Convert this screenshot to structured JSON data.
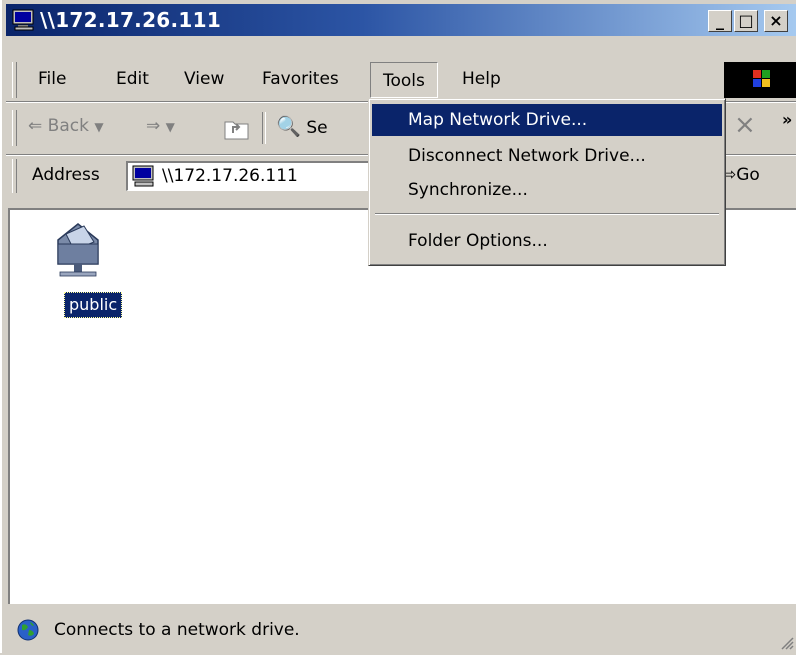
{
  "window": {
    "title": "\\\\172.17.26.111",
    "controls": {
      "minimize": "_",
      "maximize": "□",
      "close": "×"
    }
  },
  "menubar": {
    "items": [
      {
        "label": "File"
      },
      {
        "label": "Edit"
      },
      {
        "label": "View"
      },
      {
        "label": "Favorites"
      },
      {
        "label": "Tools"
      },
      {
        "label": "Help"
      }
    ]
  },
  "toolbar": {
    "back_label": "Back",
    "search_label_partial": "Se",
    "chevron": "»"
  },
  "address_bar": {
    "label": "Address",
    "value": "\\\\172.17.26.111",
    "go_label": "Go"
  },
  "tools_menu": {
    "items": [
      {
        "label": "Map Network Drive...",
        "highlighted": true
      },
      {
        "label": "Disconnect Network Drive...",
        "highlighted": false
      },
      {
        "label": "Synchronize...",
        "highlighted": false
      },
      {
        "label": "Folder Options...",
        "highlighted": false
      }
    ]
  },
  "content": {
    "items": [
      {
        "label": "public",
        "icon": "shared-folder-icon",
        "selected": true
      }
    ]
  },
  "status_bar": {
    "text": "Connects to a network drive.",
    "icon": "globe-icon"
  },
  "colors": {
    "titlebar_start": "#0a246a",
    "titlebar_end": "#a6caf0",
    "face": "#d4d0c8",
    "highlight": "#0a246a"
  }
}
